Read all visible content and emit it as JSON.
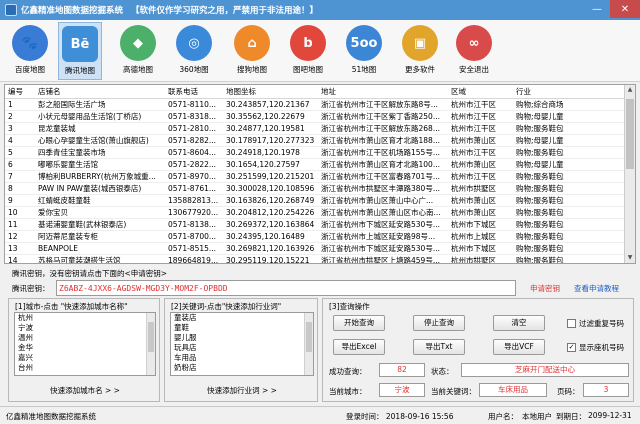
{
  "window": {
    "title": "亿鑫精准地图数据挖掘系统",
    "notice": "【软件仅作学习研究之用，严禁用于非法用途！】",
    "min_glyph": "—",
    "close_glyph": "✕"
  },
  "toolbar": {
    "items": [
      {
        "label": "百度地图",
        "icon": "baidu-map-icon",
        "glyph": "🐾",
        "color": "#3a7bd5"
      },
      {
        "label": "腾讯地图",
        "icon": "tencent-map-icon",
        "glyph": "Bē",
        "color": "#3f8fd8"
      },
      {
        "label": "高德地图",
        "icon": "gaode-map-icon",
        "glyph": "◆",
        "color": "#4caf6a"
      },
      {
        "label": "360地图",
        "icon": "360-map-icon",
        "glyph": "◎",
        "color": "#3b8ad9"
      },
      {
        "label": "搜狗地图",
        "icon": "sogou-map-icon",
        "glyph": "⌂",
        "color": "#ef8a2a"
      },
      {
        "label": "图吧地图",
        "icon": "tuba-map-icon",
        "glyph": "b",
        "color": "#e2473b"
      },
      {
        "label": "51地图",
        "icon": "51-map-icon",
        "glyph": "5oo",
        "color": "#3b87d6"
      },
      {
        "label": "更多软件",
        "icon": "more-software-icon",
        "glyph": "▣",
        "color": "#e2a52b"
      },
      {
        "label": "安全退出",
        "icon": "exit-icon",
        "glyph": "∞",
        "color": "#d94b4b"
      }
    ]
  },
  "table": {
    "columns": [
      "编号",
      "店铺名",
      "联系电话",
      "地图坐标",
      "地址",
      "区域",
      "行业"
    ],
    "rows": [
      [
        "1",
        "彭之船国际生活广场",
        "0571-8110...",
        "30.243857,120.21367",
        "浙江省杭州市江干区解放东路8号...",
        "杭州市江干区",
        "购物;综合商场"
      ],
      [
        "2",
        "小状元母婴用品生活馆(丁桥店)",
        "0571-8318...",
        "30.35562,120.22679",
        "浙江省杭州市江干区紫丁香路250...",
        "杭州市江干区",
        "购物;母婴儿童"
      ],
      [
        "3",
        "昆龙童装城",
        "0571-2810...",
        "30.24877,120.19581",
        "浙江省杭州市江干区解放东路268...",
        "杭州市江干区",
        "购物;服务鞋包"
      ],
      [
        "4",
        "心眼心孕婴童生活馆(萧山旗舰店)",
        "0571-8282...",
        "30.178917,120.277323",
        "浙江省杭州市萧山区育才北路188...",
        "杭州市萧山区",
        "购物;母婴儿童"
      ],
      [
        "5",
        "四季青佳宝童装市场",
        "0571-8604...",
        "30.24918,120.1978",
        "浙江省杭州市江干区机场路155号...",
        "杭州市江干区",
        "购物;服务鞋包"
      ],
      [
        "6",
        "嘟嘟乐婴童生活馆",
        "0571-2822...",
        "30.1654,120.27597",
        "浙江省杭州市萧山区育才北路100...",
        "杭州市萧山区",
        "购物;母婴儿童"
      ],
      [
        "7",
        "博柏利BURBERRY(杭州万象城重...",
        "0571-8970...",
        "30.251599,120.215201",
        "浙江省杭州市江干区富春路701号...",
        "杭州市江干区",
        "购物;服务鞋包"
      ],
      [
        "8",
        "PAW IN PAW童装(城西银泰店)",
        "0571-8761...",
        "30.300028,120.108596",
        "浙江省杭州市拱墅区丰潭路380号...",
        "杭州市拱墅区",
        "购物;服务鞋包"
      ],
      [
        "9",
        "红蜻蜓皮鞋童鞋",
        "135882813...",
        "30.163826,120.268749",
        "浙江省杭州市萧山区萧山中心广...",
        "杭州市萧山区",
        "购物;服务鞋包"
      ],
      [
        "10",
        "爱你宝贝",
        "130677920...",
        "30.204812,120.254226",
        "浙江省杭州市萧山区萧山区市心南...",
        "杭州市萧山区",
        "购物;服务鞋包"
      ],
      [
        "11",
        "基诺浦婴童鞋(武林银泰店)",
        "0571-8138...",
        "30.269372,120.163864",
        "浙江省杭州市下城区延安路530号...",
        "杭州市下城区",
        "购物;服务鞋包"
      ],
      [
        "12",
        "阿迈蒂尼童装专柜",
        "0571-8700...",
        "30.24395,120.16489",
        "浙江省杭州市上城区延安路98号...",
        "杭州市上城区",
        "购物;服务鞋包"
      ],
      [
        "13",
        "BEANPOLE",
        "0571-8515...",
        "30.269821,120.163926",
        "浙江省杭州市下城区延安路530号...",
        "杭州市下城区",
        "购物;服务鞋包"
      ],
      [
        "14",
        "苏格马可童装潮搭生活馆",
        "189664819...",
        "30.295119,120.15221",
        "浙江省杭州市拱墅区上塘路459号...",
        "杭州市拱墅区",
        "购物;服务鞋包"
      ]
    ]
  },
  "key": {
    "info": "腾讯密钥，没有密钥请点击下面的<申请密钥>",
    "label": "腾讯密钥：",
    "value": "Z6ABZ-4JXX6-AGDSW-MGD3Y-MOM2F-OPBDD",
    "apply_link": "申请密钥",
    "tutorial_link": "查看申请教程"
  },
  "city_panel": {
    "title": "[1]城市-点击 \"快速添加城市名称\"",
    "items": [
      "杭州",
      "宁波",
      "温州",
      "金华",
      "嘉兴",
      "台州"
    ],
    "add_button": "快速添加城市名 > >"
  },
  "keyword_panel": {
    "title": "[2]关键词-点击\"快速添加行业词\"",
    "items": [
      "童装店",
      "童鞋",
      "婴儿服",
      "玩具店",
      "车用品",
      "奶粉店"
    ],
    "add_button": "快速添加行业词 > >"
  },
  "ops_panel": {
    "title": "[3]查询操作",
    "buttons": {
      "start": "开始查询",
      "stop": "停止查询",
      "clear": "清空",
      "export_excel": "导出Excel",
      "export_txt": "导出Txt",
      "export_vcf": "导出VCF"
    },
    "checkboxes": {
      "filter_dup": {
        "label": "过滤重复号码",
        "checked": false
      },
      "show_mobile": {
        "label": "显示座机号码",
        "checked": true
      }
    },
    "stats": {
      "success_label": "成功查询：",
      "success_value": "82",
      "status_label": "状态：",
      "status_value": "芝麻开门配送中心",
      "city_label": "当前城市：",
      "city_value": "宁波",
      "keyword_label": "当前关键词：",
      "keyword_value": "车床用品",
      "page_label": "页码：",
      "page_value": "3"
    }
  },
  "statusbar": {
    "app": "亿鑫精准地图数据挖掘系统",
    "login_time": "登录时间：  2018-09-16 15:56",
    "user": "用户名：",
    "user_value": "本地用户",
    "expiry": "到期日：",
    "expiry_value": "2099-12-31"
  }
}
